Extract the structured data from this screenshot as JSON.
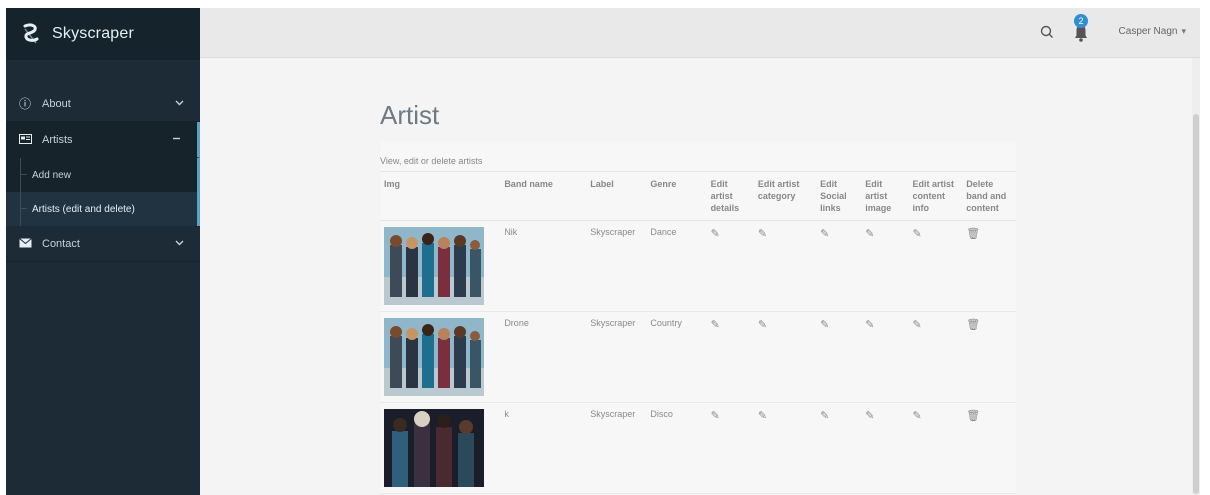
{
  "app": {
    "name": "Skyscraper"
  },
  "sidebar": {
    "items": [
      {
        "label": "About",
        "icon": "info-icon"
      },
      {
        "label": "Artists",
        "icon": "card-icon",
        "active": true,
        "children": [
          {
            "label": "Add new"
          },
          {
            "label": "Artists (edit and delete)",
            "current": true
          }
        ]
      },
      {
        "label": "Contact",
        "icon": "envelope-icon"
      }
    ]
  },
  "header": {
    "notifications_count": "2",
    "user_name": "Casper Nagn",
    "caret": "▾"
  },
  "main": {
    "title": "Artist",
    "description": "View, edit or delete artists",
    "columns": [
      "Img",
      "Band name",
      "Label",
      "Genre",
      "Edit artist details",
      "Edit artist category",
      "Edit Social links",
      "Edit artist image",
      "Edit artist content info",
      "Delete band and content"
    ],
    "rows": [
      {
        "band": "Nik",
        "label": "Skyscraper",
        "genre": "Dance"
      },
      {
        "band": "Drone",
        "label": "Skyscraper",
        "genre": "Country"
      },
      {
        "band": "k",
        "label": "Skyscraper",
        "genre": "Disco"
      }
    ]
  },
  "colors": {
    "sidebar_bg": "#1c2b36",
    "accent": "#5aa0c8",
    "badge": "#2f8fd1"
  }
}
